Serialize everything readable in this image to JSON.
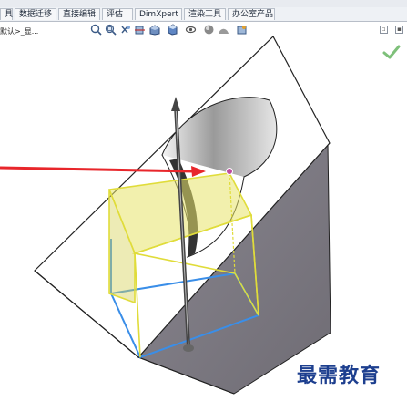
{
  "tabs": [
    {
      "label": "具"
    },
    {
      "label": "数据迁移"
    },
    {
      "label": "直接编辑"
    },
    {
      "label": "评估"
    },
    {
      "label": "DimXpert"
    },
    {
      "label": "渲染工具"
    },
    {
      "label": "办公室产品"
    }
  ],
  "breadcrumb": "默认>_显...",
  "watermark": "最需教育",
  "icons": {
    "hud": [
      "zoom-to-fit-icon",
      "zoom-area-icon",
      "previous-view-icon",
      "section-view-icon",
      "view-orientation-icon",
      "display-style-icon",
      "hide-show-icon",
      "edit-appearance-icon",
      "apply-scene-icon",
      "view-settings-icon"
    ],
    "window": [
      "restore-icon",
      "tile-icon"
    ],
    "confirm": "green-check-icon"
  },
  "colors": {
    "arrow": "#e8262b",
    "selection_yellow": "#e8e36a",
    "selection_blue": "#3a8ee8",
    "body_face": "#ffffff",
    "body_side": "#7b7880"
  }
}
